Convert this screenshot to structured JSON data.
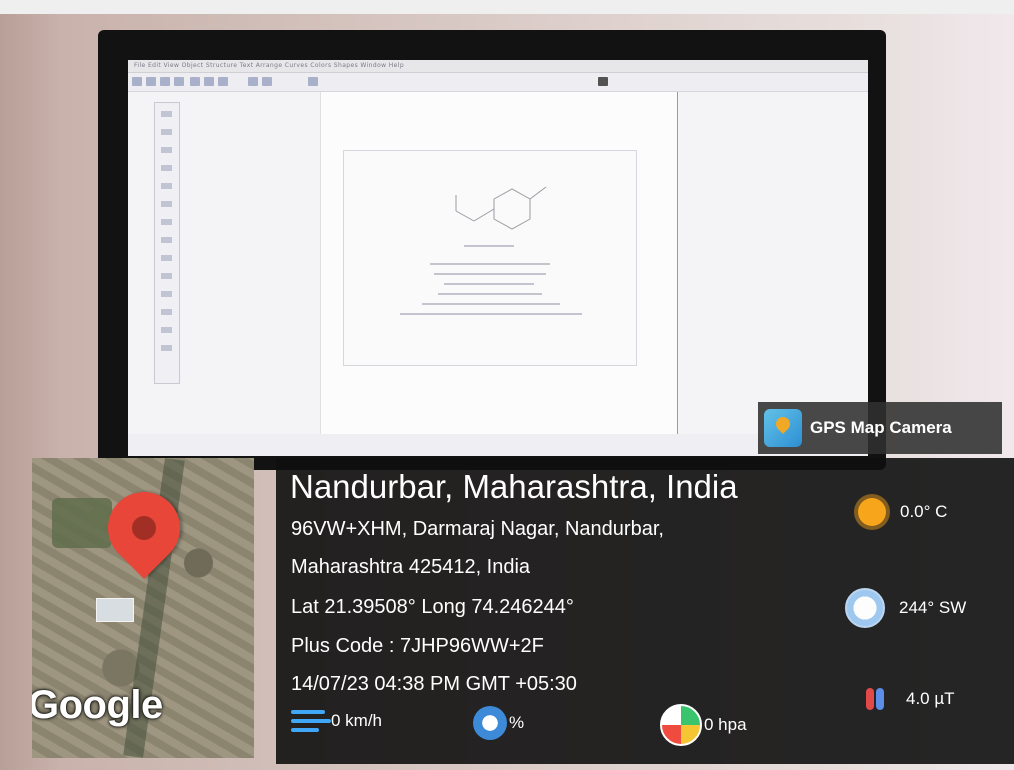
{
  "overlay": {
    "app_name": "GPS Map Camera",
    "location_title": "Nandurbar, Maharashtra, India",
    "address_line1": "96VW+XHM, Darmaraj Nagar, Nandurbar,",
    "address_line2": "Maharashtra 425412, India",
    "coordinates": "Lat 21.39508° Long 74.246244°",
    "plus_code": "Plus Code : 7JHP96WW+2F",
    "datetime": "14/07/23 04:38 PM GMT +05:30",
    "map_label": "Google",
    "metrics": {
      "temperature": "0.0° C",
      "wind_direction": "244° SW",
      "magnetic_field": "4.0 µT",
      "wind_speed": "0 km/h",
      "humidity": "%",
      "pressure": "0 hpa"
    }
  },
  "background_screen": {
    "menu_text": "File  Edit  View  Object  Structure  Text  Arrange  Curves  Colors  Shapes  Window  Help"
  }
}
